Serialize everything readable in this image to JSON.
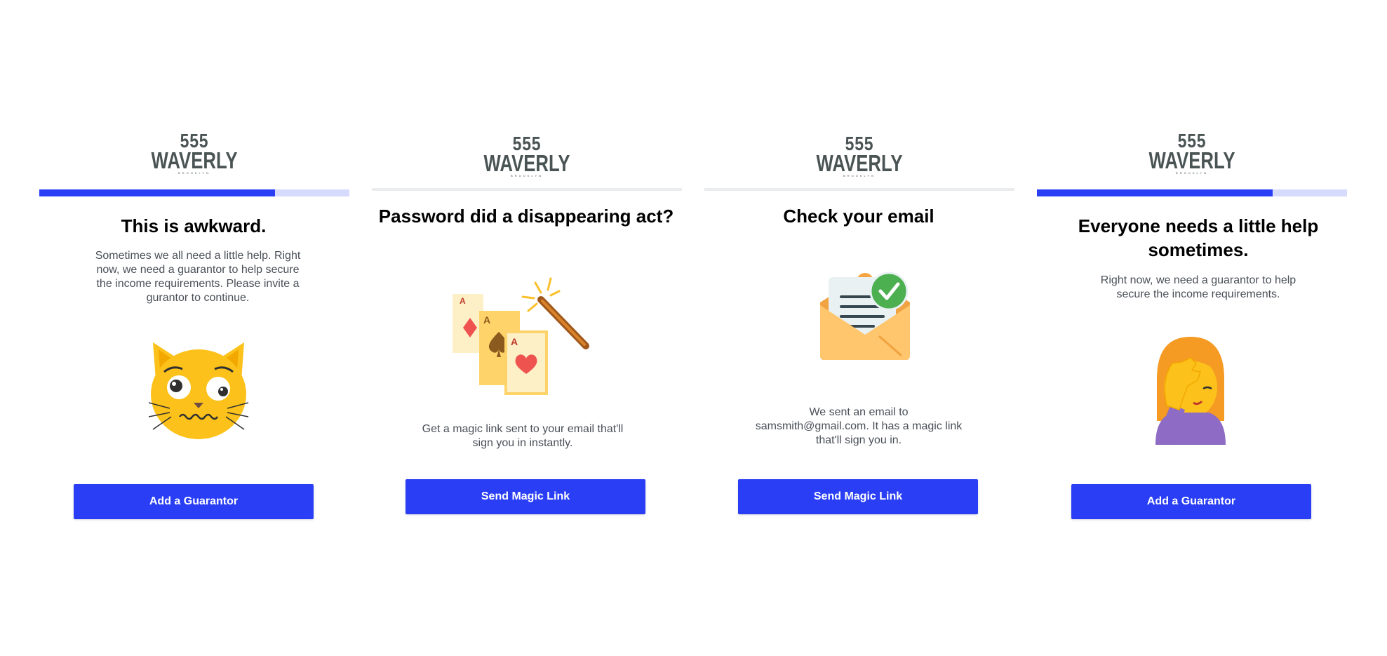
{
  "brand": {
    "line1": "555",
    "line2": "WAVERLY",
    "line3": "BROOKLYN"
  },
  "colors": {
    "primary": "#2a3ff5",
    "progress_track": "#d6dafc",
    "text_muted": "#4a4f57",
    "logo": "#4b5454"
  },
  "panels": [
    {
      "progress": 0.76,
      "title": "This is awkward.",
      "description": "Sometimes we all need a little help. Right now, we need a guarantor to help secure the income requirements. Please invite a gurantor to continue.",
      "icon": "anxious-cat-icon",
      "button": "Add a Guarantor"
    },
    {
      "progress": 0,
      "title": "Password did a disappearing act?",
      "description": "Get a magic link sent to your email that'll sign you in instantly.",
      "icon": "magic-cards-wand-icon",
      "button": "Send Magic Link"
    },
    {
      "progress": 0,
      "title": "Check your email",
      "description": "We sent an email to samsmith@gmail.com. It has a magic link that'll sign you in.",
      "icon": "email-sent-check-icon",
      "button": "Send Magic Link"
    },
    {
      "progress": 0.76,
      "title": "Everyone needs a little help sometimes.",
      "description": "Right now, we need a guarantor to help secure the income requirements.",
      "icon": "facepalm-woman-icon",
      "button": "Add a Guarantor"
    }
  ]
}
